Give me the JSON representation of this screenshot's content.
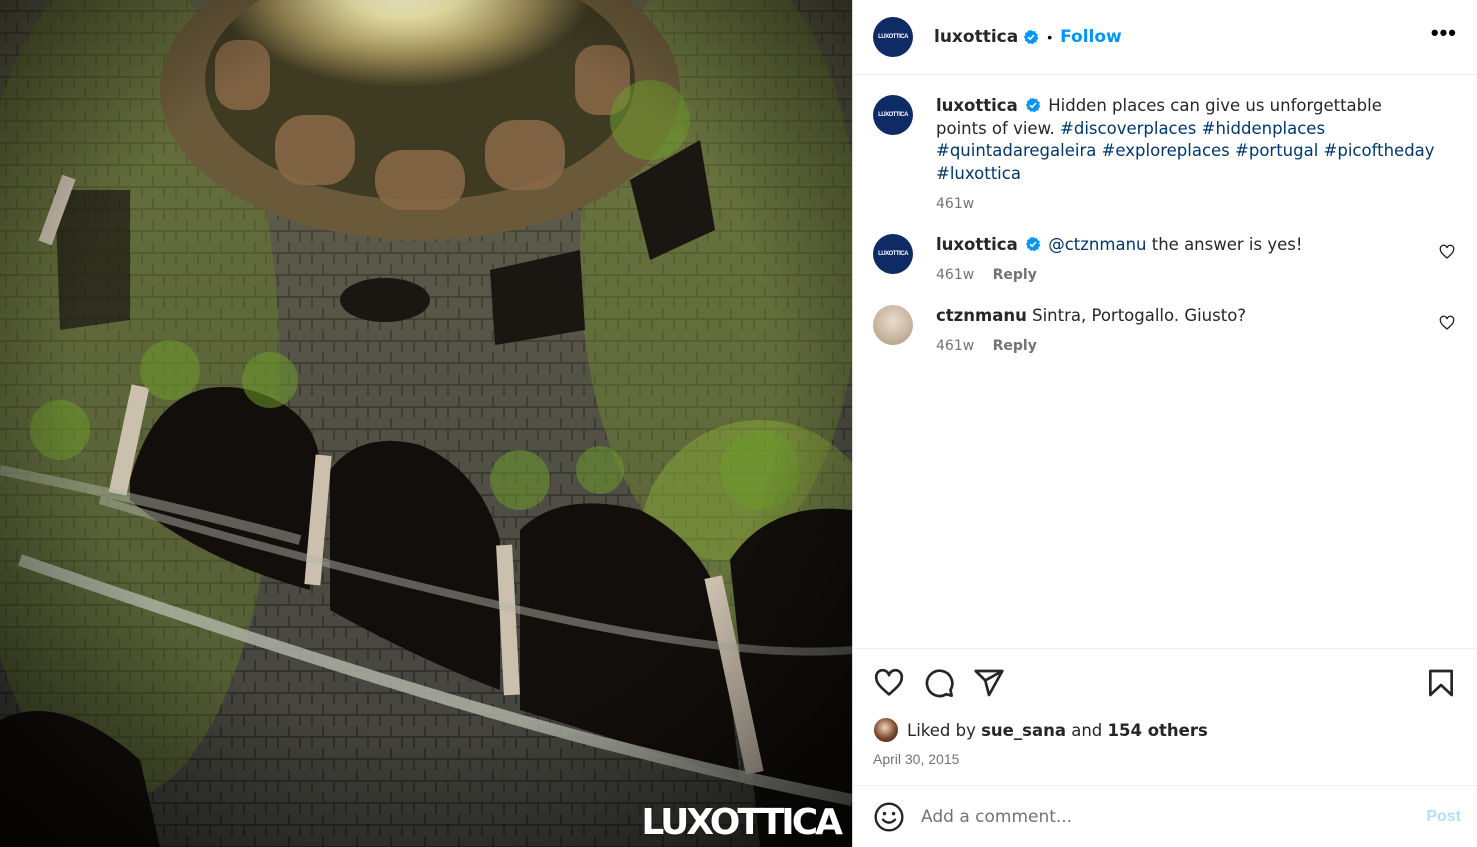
{
  "post": {
    "author": "luxottica",
    "follow_label": "Follow",
    "separator": "•",
    "more_label": "•••",
    "avatar_text": "LUXOTTICA",
    "watermark_text": "LUXOTTICA",
    "caption": {
      "username": "luxottica",
      "text": "Hidden places can give us unforgettable points of view.",
      "tags": [
        "#discoverplaces",
        "#hiddenplaces",
        "#quintadaregaleira",
        "#exploreplaces",
        "#portugal",
        "#picoftheday",
        "#luxottica"
      ],
      "age": "461w"
    },
    "comments": [
      {
        "username": "luxottica",
        "mention": "@ctznmanu",
        "text": "the answer is yes!",
        "age": "461w",
        "reply_label": "Reply"
      },
      {
        "username": "ctznmanu",
        "mention": "",
        "text": "Sintra, Portogallo. Giusto?",
        "age": "461w",
        "reply_label": "Reply"
      }
    ],
    "likes": {
      "prefix": "Liked by",
      "first_user": "sue_sana",
      "joiner": "and",
      "others": "154 others"
    },
    "date": "April 30, 2015",
    "add_comment_placeholder": "Add a comment...",
    "post_label": "Post"
  },
  "colors": {
    "link": "#0095f6",
    "hashtag": "#00376b",
    "verified": "#0095f6",
    "brand_navy": "#0e2b66"
  },
  "icons": [
    "verified-badge-icon",
    "more-options-icon",
    "heart-icon",
    "comment-icon",
    "share-icon",
    "bookmark-icon",
    "emoji-icon"
  ]
}
